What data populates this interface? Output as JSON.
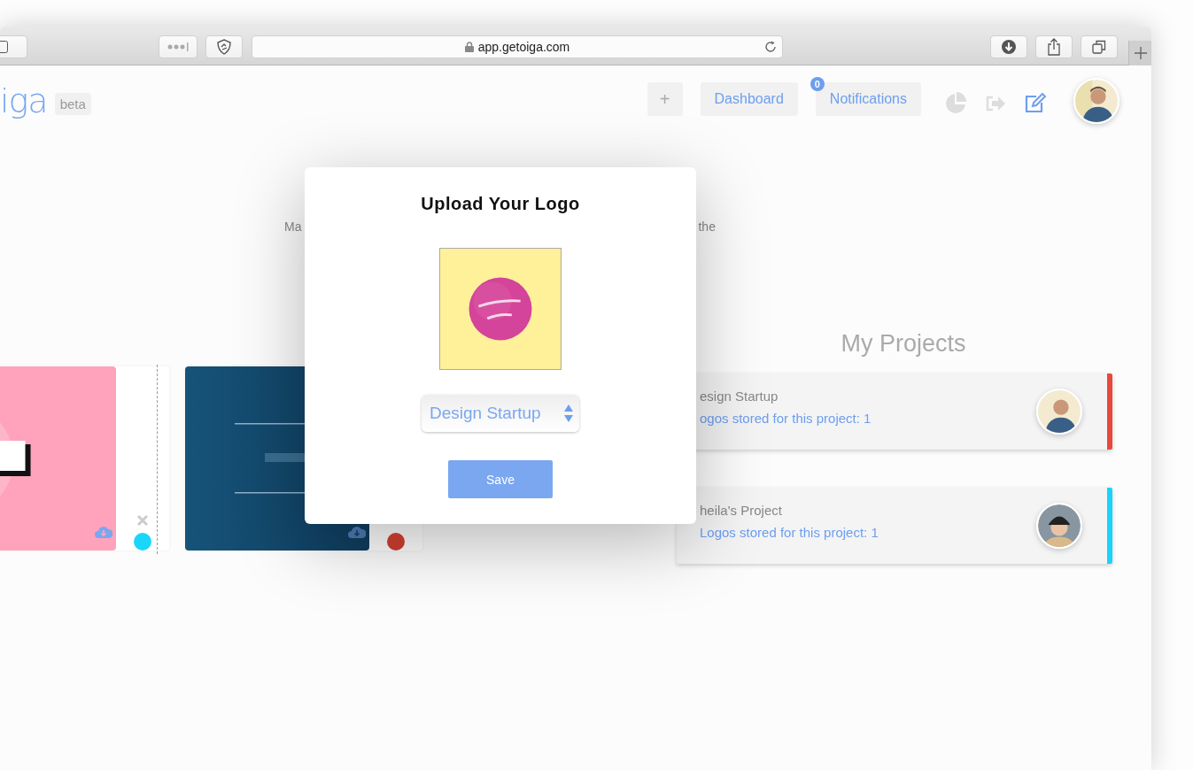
{
  "browser": {
    "url": "app.getoiga.com"
  },
  "header": {
    "logo": "iga",
    "badge": "beta",
    "add_button": "+",
    "nav": [
      {
        "label": "Dashboard"
      },
      {
        "label": "Notifications",
        "count": "0"
      }
    ]
  },
  "intro": {
    "texts": [
      "Ma",
      "the"
    ]
  },
  "logo_cards": [
    {
      "kind": "picture",
      "color": "#1ad6fb",
      "removable": true
    },
    {
      "kind": "picture",
      "color": "#b5372a",
      "removable": false
    }
  ],
  "projects": {
    "title": "My Projects",
    "items": [
      {
        "name": "esign Startup",
        "detail": "ogos stored for this project: 1",
        "color": "#e8483b"
      },
      {
        "name": "heila's Project",
        "detail": "Logos stored for this project: 1",
        "color": "#1ad3f8"
      }
    ]
  },
  "modal": {
    "title": "Upload Your Logo",
    "project_select": {
      "value": "Design Startup"
    },
    "save": "Save"
  }
}
